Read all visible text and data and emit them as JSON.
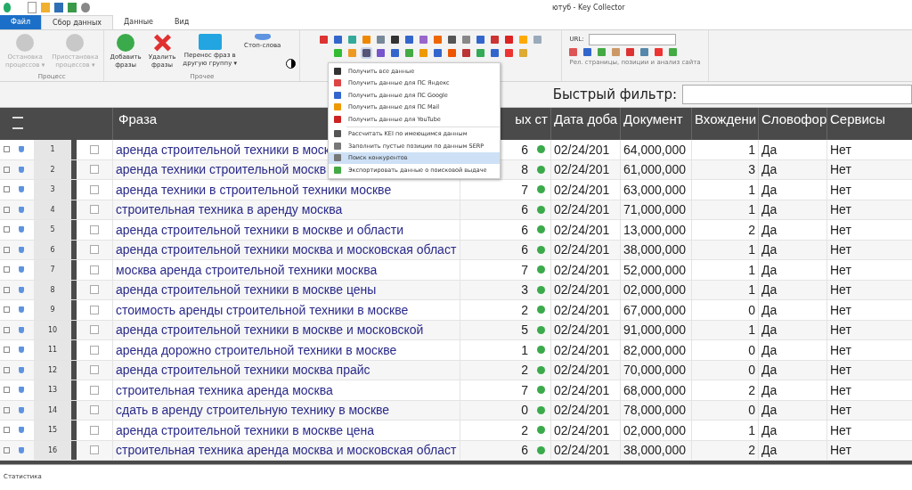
{
  "window": {
    "title": "ютуб - Key Collector"
  },
  "tabs": [
    {
      "label": "Файл",
      "kind": "file",
      "selected": false
    },
    {
      "label": "Сбор данных",
      "kind": "tab",
      "selected": true
    },
    {
      "label": "Данные",
      "kind": "tab",
      "selected": false
    },
    {
      "label": "Вид",
      "kind": "tab",
      "selected": false
    }
  ],
  "ribbon": {
    "groups": [
      {
        "label": "Процесс",
        "buttons": [
          {
            "label": "Остановка\nпроцессов ▾",
            "disabled": true
          },
          {
            "label": "Приостановка\nпроцессов ▾",
            "disabled": true
          }
        ]
      },
      {
        "label": "Прочее",
        "buttons": [
          {
            "label": "Добавить\nфразы",
            "disabled": false
          },
          {
            "label": "Удалить\nфразы",
            "disabled": false
          },
          {
            "label": "Перенос фраз в\nдругую группу ▾",
            "disabled": false
          },
          {
            "label": "Стоп-слова",
            "disabled": false
          }
        ]
      }
    ],
    "site_group": {
      "url_label": "URL:",
      "label": "Рел. страницы, позиции и анализ сайта"
    }
  },
  "quick_filter": {
    "label": "Быстрый фильтр:"
  },
  "menu": {
    "items": [
      {
        "label": "Получить все данные",
        "selected": false
      },
      {
        "label": "Получить данные для ПС Яндекс",
        "selected": false
      },
      {
        "label": "Получить данные для ПС Google",
        "selected": false
      },
      {
        "label": "Получить данные для ПС Mail",
        "selected": false
      },
      {
        "label": "Получить данные для YouTube",
        "selected": false
      },
      {
        "label": "Рассчитать KEI по имеющимся данным",
        "selected": false
      },
      {
        "label": "Заполнить пустые позиции по данным SERP",
        "selected": false
      },
      {
        "label": "Поиск конкурентов",
        "selected": true
      },
      {
        "label": "Экспортировать данные о поисковой выдаче",
        "selected": false
      }
    ]
  },
  "table": {
    "columns": [
      "Фраза",
      "ых ст",
      "Дата доба",
      "Документ",
      "Вхождени",
      "Словофор",
      "Сервисы"
    ],
    "rows": [
      {
        "n": "1",
        "checked": false,
        "phrase": "аренда строительной техники в моск",
        "c": "6",
        "date": "02/24/201",
        "docs": "64,000,000",
        "occ": "1",
        "wf": "Да",
        "sv": "Нет"
      },
      {
        "n": "2",
        "checked": false,
        "phrase": "аренда техники строительной москв",
        "c": "8",
        "date": "02/24/201",
        "docs": "61,000,000",
        "occ": "3",
        "wf": "Да",
        "sv": "Нет"
      },
      {
        "n": "3",
        "checked": false,
        "phrase": "аренда техники в строительной техники москве",
        "c": "7",
        "date": "02/24/201",
        "docs": "63,000,000",
        "occ": "1",
        "wf": "Да",
        "sv": "Нет"
      },
      {
        "n": "4",
        "checked": false,
        "phrase": "строительная техника в аренду москва",
        "c": "6",
        "date": "02/24/201",
        "docs": "71,000,000",
        "occ": "1",
        "wf": "Да",
        "sv": "Нет"
      },
      {
        "n": "5",
        "checked": false,
        "phrase": "аренда строительной техники в москве и области",
        "c": "6",
        "date": "02/24/201",
        "docs": "13,000,000",
        "occ": "2",
        "wf": "Да",
        "sv": "Нет"
      },
      {
        "n": "6",
        "checked": false,
        "phrase": "аренда строительной техники москва и московская област",
        "c": "6",
        "date": "02/24/201",
        "docs": "38,000,000",
        "occ": "1",
        "wf": "Да",
        "sv": "Нет"
      },
      {
        "n": "7",
        "checked": false,
        "phrase": "москва аренда строительной техники москва",
        "c": "7",
        "date": "02/24/201",
        "docs": "52,000,000",
        "occ": "1",
        "wf": "Да",
        "sv": "Нет"
      },
      {
        "n": "8",
        "checked": false,
        "phrase": "аренда строительной техники в москве цены",
        "c": "3",
        "date": "02/24/201",
        "docs": "02,000,000",
        "occ": "1",
        "wf": "Да",
        "sv": "Нет"
      },
      {
        "n": "9",
        "checked": false,
        "phrase": "стоимость аренды строительной техники в москве",
        "c": "2",
        "date": "02/24/201",
        "docs": "67,000,000",
        "occ": "0",
        "wf": "Да",
        "sv": "Нет"
      },
      {
        "n": "10",
        "checked": false,
        "phrase": "аренда строительной техники в москве и московской",
        "c": "5",
        "date": "02/24/201",
        "docs": "91,000,000",
        "occ": "1",
        "wf": "Да",
        "sv": "Нет"
      },
      {
        "n": "11",
        "checked": false,
        "phrase": "аренда дорожно строительной техники в москве",
        "c": "1",
        "date": "02/24/201",
        "docs": "82,000,000",
        "occ": "0",
        "wf": "Да",
        "sv": "Нет"
      },
      {
        "n": "12",
        "checked": false,
        "phrase": "аренда строительной техники москва прайс",
        "c": "2",
        "date": "02/24/201",
        "docs": "70,000,000",
        "occ": "0",
        "wf": "Да",
        "sv": "Нет"
      },
      {
        "n": "13",
        "checked": false,
        "phrase": "строительная техника аренда москва",
        "c": "7",
        "date": "02/24/201",
        "docs": "68,000,000",
        "occ": "2",
        "wf": "Да",
        "sv": "Нет"
      },
      {
        "n": "14",
        "checked": false,
        "phrase": "сдать в аренду строительную технику в москве",
        "c": "0",
        "date": "02/24/201",
        "docs": "78,000,000",
        "occ": "0",
        "wf": "Да",
        "sv": "Нет"
      },
      {
        "n": "15",
        "checked": false,
        "phrase": "аренда строительной техники в москве цена",
        "c": "2",
        "date": "02/24/201",
        "docs": "02,000,000",
        "occ": "1",
        "wf": "Да",
        "sv": "Нет"
      },
      {
        "n": "16",
        "checked": false,
        "phrase": "строительная техника аренда москва и московская област",
        "c": "6",
        "date": "02/24/201",
        "docs": "38,000,000",
        "occ": "2",
        "wf": "Да",
        "sv": "Нет"
      }
    ]
  },
  "status_bar": {
    "text": "Статистика"
  }
}
